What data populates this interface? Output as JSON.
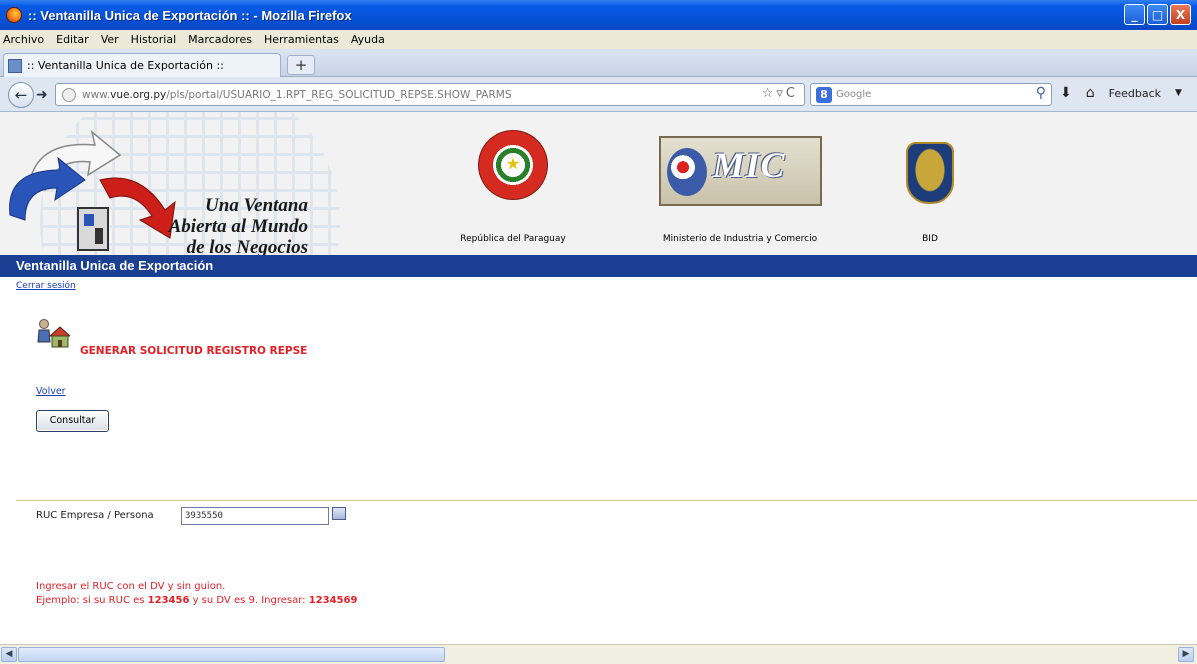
{
  "window": {
    "title": ":: Ventanilla Unica de Exportación :: - Mozilla Firefox",
    "controls": [
      "_",
      "□",
      "X"
    ]
  },
  "menu": [
    "Archivo",
    "Editar",
    "Ver",
    "Historial",
    "Marcadores",
    "Herramientas",
    "Ayuda"
  ],
  "tab": {
    "label": ":: Ventanilla Unica de Exportación ::",
    "new_tab": "+"
  },
  "nav": {
    "url_prefix": "www.",
    "url_host": "vue.org.py",
    "url_path": "/pls/portal/USUARIO_1.RPT_REG_SOLICITUD_REPSE.SHOW_PARMS",
    "search_engine": "Google",
    "feedback": "Feedback"
  },
  "header": {
    "slogan_1": "Una Ventana",
    "slogan_2": "Abierta al Mundo",
    "slogan_3": "de los Negocios",
    "sponsor_1": "República del Paraguay",
    "sponsor_2": "Ministerio de Industria y Comercio",
    "sponsor_2_logo": "MIC",
    "sponsor_3": "BID",
    "bar_title": "Ventanilla Unica de Exportación"
  },
  "content": {
    "logout": "Cerrar sesión",
    "page_title": "GENERAR SOLICITUD REGISTRO REPSE",
    "back": "Volver",
    "submit": "Consultar",
    "ruc_label": "RUC Empresa / Persona",
    "ruc_value": "3935550",
    "note_1": "Ingresar el RUC con el DV y sin guion.",
    "note_2_a": "Ejemplo: si su RUC es ",
    "note_2_b": "123456",
    "note_2_c": " y su DV es 9. Ingresar: ",
    "note_2_d": "1234569"
  },
  "colors": {
    "accent_blue": "#1b3f92",
    "alert_red": "#e31f26",
    "link": "#1c3fb8"
  }
}
